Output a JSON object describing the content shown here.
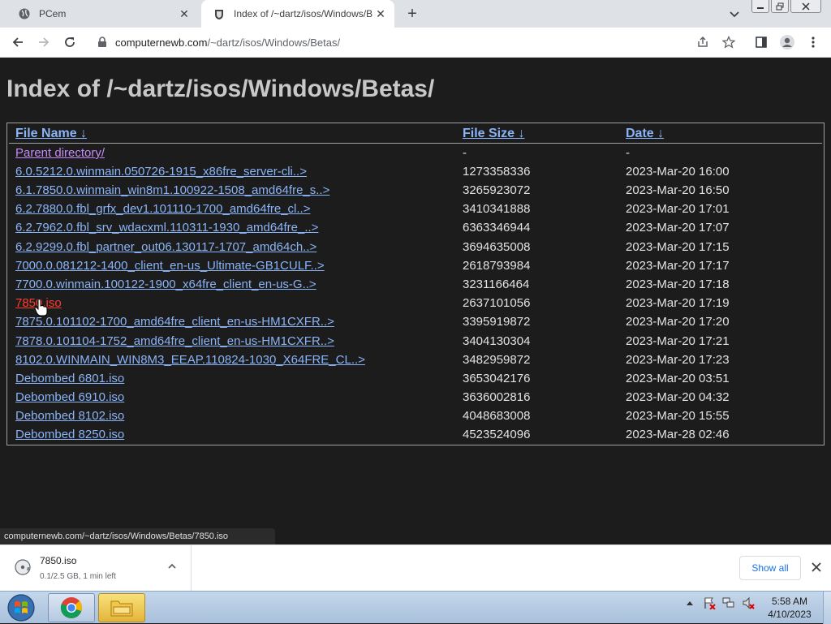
{
  "tabs": [
    {
      "title": "PCem"
    },
    {
      "title": "Index of /~dartz/isos/Windows/B"
    }
  ],
  "address": {
    "host": "computernewb.com",
    "path": "/~dartz/isos/Windows/Betas/"
  },
  "page": {
    "heading": "Index of /~dartz/isos/Windows/Betas/",
    "columns": {
      "name": "File Name",
      "size": "File Size",
      "date": "Date",
      "sort_arrow": "↓"
    },
    "rows": [
      {
        "name": "Parent directory/",
        "size": "-",
        "date": "-"
      },
      {
        "name": "6.0.5212.0.winmain.050726-1915_x86fre_server-cli..>",
        "size": "1273358336",
        "date": "2023-Mar-20 16:00"
      },
      {
        "name": "6.1.7850.0.winmain_win8m1.100922-1508_amd64fre_s..>",
        "size": "3265923072",
        "date": "2023-Mar-20 16:50"
      },
      {
        "name": "6.2.7880.0.fbl_grfx_dev1.101110-1700_amd64fre_cl..>",
        "size": "3410341888",
        "date": "2023-Mar-20 17:01"
      },
      {
        "name": "6.2.7962.0.fbl_srv_wdacxml.110311-1930_amd64fre_..>",
        "size": "6363346944",
        "date": "2023-Mar-20 17:07"
      },
      {
        "name": "6.2.9299.0.fbl_partner_out06.130117-1707_amd64ch..>",
        "size": "3694635008",
        "date": "2023-Mar-20 17:15"
      },
      {
        "name": "7000.0.081212-1400_client_en-us_Ultimate-GB1CULF..>",
        "size": "2618793984",
        "date": "2023-Mar-20 17:17"
      },
      {
        "name": "7700.0.winmain.100122-1900_x64fre_client_en-us-G..>",
        "size": "3231166464",
        "date": "2023-Mar-20 17:18"
      },
      {
        "name": "7850.iso",
        "size": "2637101056",
        "date": "2023-Mar-20 17:19"
      },
      {
        "name": "7875.0.101102-1700_amd64fre_client_en-us-HM1CXFR..>",
        "size": "3395919872",
        "date": "2023-Mar-20 17:20"
      },
      {
        "name": "7878.0.101104-1752_amd64fre_client_en-us-HM1CXFR..>",
        "size": "3404130304",
        "date": "2023-Mar-20 17:21"
      },
      {
        "name": "8102.0.WINMAIN_WIN8M3_EEAP.110824-1030_X64FRE_CL..>",
        "size": "3482959872",
        "date": "2023-Mar-20 17:23"
      },
      {
        "name": "Debombed 6801.iso",
        "size": "3653042176",
        "date": "2023-Mar-20 03:51"
      },
      {
        "name": "Debombed 6910.iso",
        "size": "3636002816",
        "date": "2023-Mar-20 04:32"
      },
      {
        "name": "Debombed 8102.iso",
        "size": "4048683008",
        "date": "2023-Mar-20 15:55"
      },
      {
        "name": "Debombed 8250.iso",
        "size": "4523524096",
        "date": "2023-Mar-28 02:46"
      }
    ]
  },
  "statusbar": {
    "text": "computernewb.com/~dartz/isos/Windows/Betas/7850.iso"
  },
  "download": {
    "name": "7850.iso",
    "status": "0.1/2.5 GB, 1 min left",
    "show_all": "Show all"
  },
  "taskbar": {
    "time": "5:58 AM",
    "date": "4/10/2023"
  },
  "colors": {
    "link": "#8ab4f8",
    "visited": "#c58af9",
    "hover": "#ff3b30",
    "page_bg": "#1c1c1c"
  }
}
